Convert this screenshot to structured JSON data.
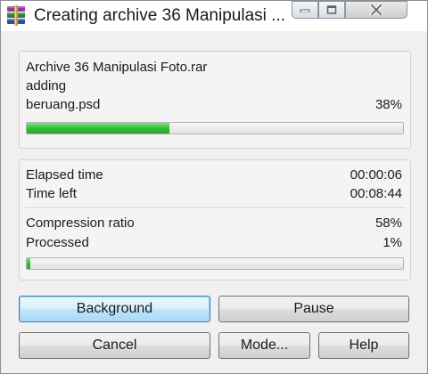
{
  "window": {
    "title": "Creating archive 36 Manipulasi ..."
  },
  "status": {
    "archive_name": "Archive 36 Manipulasi Foto.rar",
    "operation": "adding",
    "current_file": "beruang.psd",
    "file_percent": "38%",
    "file_progress": 0.38
  },
  "stats": {
    "elapsed_label": "Elapsed time",
    "elapsed_value": "00:00:06",
    "time_left_label": "Time left",
    "time_left_value": "00:08:44",
    "compression_label": "Compression ratio",
    "compression_value": "58%",
    "processed_label": "Processed",
    "processed_value": "1%",
    "total_progress": 0.01
  },
  "buttons": {
    "background": "Background",
    "pause": "Pause",
    "cancel": "Cancel",
    "mode": "Mode...",
    "help": "Help"
  },
  "icons": {
    "app": "winrar-books-icon",
    "minimize": "minimize-icon",
    "maximize": "maximize-icon",
    "close": "close-icon"
  },
  "colors": {
    "progress_green": "#2fba33",
    "default_button_border": "#3c7fb1"
  }
}
